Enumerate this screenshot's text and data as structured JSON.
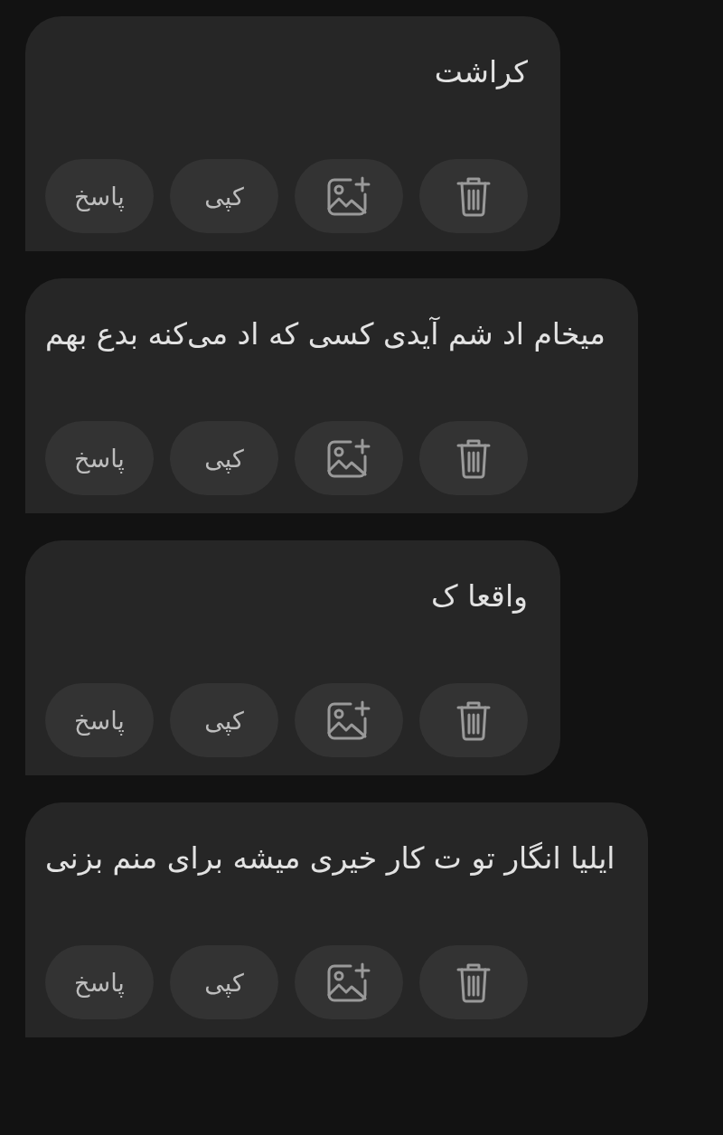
{
  "messages": [
    {
      "text": "کراشت",
      "actions": [
        {
          "kind": "delete"
        },
        {
          "kind": "image_add"
        },
        {
          "kind": "text",
          "label": "کپی"
        },
        {
          "kind": "text",
          "label": "پاسخ"
        }
      ]
    },
    {
      "text": "میخام اد شم آیدی کسی که اد می‌کنه بدع بهم",
      "actions": [
        {
          "kind": "delete"
        },
        {
          "kind": "image_add"
        },
        {
          "kind": "text",
          "label": "کپی"
        },
        {
          "kind": "text",
          "label": "پاسخ"
        }
      ]
    },
    {
      "text": "واقعا ک",
      "actions": [
        {
          "kind": "delete"
        },
        {
          "kind": "image_add"
        },
        {
          "kind": "text",
          "label": "کپی"
        },
        {
          "kind": "text",
          "label": "پاسخ"
        }
      ]
    },
    {
      "text": "ایلیا انگار تو ت کار خیری میشه برای منم بزنی",
      "actions": [
        {
          "kind": "delete"
        },
        {
          "kind": "image_add"
        },
        {
          "kind": "text",
          "label": "کپی"
        },
        {
          "kind": "text",
          "label": "پاسخ"
        }
      ]
    }
  ]
}
